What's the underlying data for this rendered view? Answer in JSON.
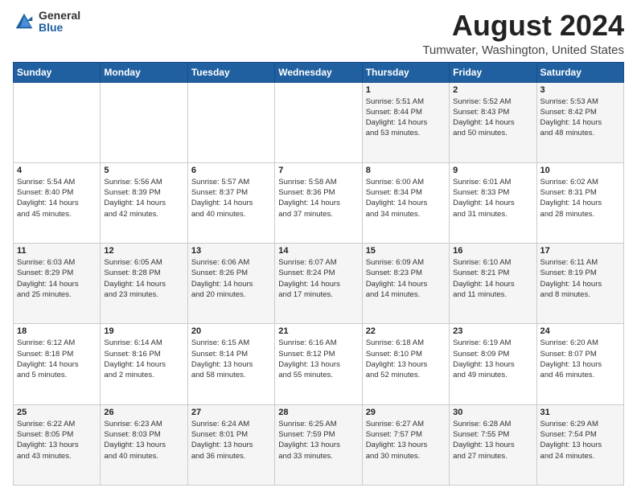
{
  "logo": {
    "general": "General",
    "blue": "Blue"
  },
  "header": {
    "title": "August 2024",
    "subtitle": "Tumwater, Washington, United States"
  },
  "calendar": {
    "days_of_week": [
      "Sunday",
      "Monday",
      "Tuesday",
      "Wednesday",
      "Thursday",
      "Friday",
      "Saturday"
    ],
    "weeks": [
      [
        {
          "day": "",
          "info": ""
        },
        {
          "day": "",
          "info": ""
        },
        {
          "day": "",
          "info": ""
        },
        {
          "day": "",
          "info": ""
        },
        {
          "day": "1",
          "info": "Sunrise: 5:51 AM\nSunset: 8:44 PM\nDaylight: 14 hours\nand 53 minutes."
        },
        {
          "day": "2",
          "info": "Sunrise: 5:52 AM\nSunset: 8:43 PM\nDaylight: 14 hours\nand 50 minutes."
        },
        {
          "day": "3",
          "info": "Sunrise: 5:53 AM\nSunset: 8:42 PM\nDaylight: 14 hours\nand 48 minutes."
        }
      ],
      [
        {
          "day": "4",
          "info": "Sunrise: 5:54 AM\nSunset: 8:40 PM\nDaylight: 14 hours\nand 45 minutes."
        },
        {
          "day": "5",
          "info": "Sunrise: 5:56 AM\nSunset: 8:39 PM\nDaylight: 14 hours\nand 42 minutes."
        },
        {
          "day": "6",
          "info": "Sunrise: 5:57 AM\nSunset: 8:37 PM\nDaylight: 14 hours\nand 40 minutes."
        },
        {
          "day": "7",
          "info": "Sunrise: 5:58 AM\nSunset: 8:36 PM\nDaylight: 14 hours\nand 37 minutes."
        },
        {
          "day": "8",
          "info": "Sunrise: 6:00 AM\nSunset: 8:34 PM\nDaylight: 14 hours\nand 34 minutes."
        },
        {
          "day": "9",
          "info": "Sunrise: 6:01 AM\nSunset: 8:33 PM\nDaylight: 14 hours\nand 31 minutes."
        },
        {
          "day": "10",
          "info": "Sunrise: 6:02 AM\nSunset: 8:31 PM\nDaylight: 14 hours\nand 28 minutes."
        }
      ],
      [
        {
          "day": "11",
          "info": "Sunrise: 6:03 AM\nSunset: 8:29 PM\nDaylight: 14 hours\nand 25 minutes."
        },
        {
          "day": "12",
          "info": "Sunrise: 6:05 AM\nSunset: 8:28 PM\nDaylight: 14 hours\nand 23 minutes."
        },
        {
          "day": "13",
          "info": "Sunrise: 6:06 AM\nSunset: 8:26 PM\nDaylight: 14 hours\nand 20 minutes."
        },
        {
          "day": "14",
          "info": "Sunrise: 6:07 AM\nSunset: 8:24 PM\nDaylight: 14 hours\nand 17 minutes."
        },
        {
          "day": "15",
          "info": "Sunrise: 6:09 AM\nSunset: 8:23 PM\nDaylight: 14 hours\nand 14 minutes."
        },
        {
          "day": "16",
          "info": "Sunrise: 6:10 AM\nSunset: 8:21 PM\nDaylight: 14 hours\nand 11 minutes."
        },
        {
          "day": "17",
          "info": "Sunrise: 6:11 AM\nSunset: 8:19 PM\nDaylight: 14 hours\nand 8 minutes."
        }
      ],
      [
        {
          "day": "18",
          "info": "Sunrise: 6:12 AM\nSunset: 8:18 PM\nDaylight: 14 hours\nand 5 minutes."
        },
        {
          "day": "19",
          "info": "Sunrise: 6:14 AM\nSunset: 8:16 PM\nDaylight: 14 hours\nand 2 minutes."
        },
        {
          "day": "20",
          "info": "Sunrise: 6:15 AM\nSunset: 8:14 PM\nDaylight: 13 hours\nand 58 minutes."
        },
        {
          "day": "21",
          "info": "Sunrise: 6:16 AM\nSunset: 8:12 PM\nDaylight: 13 hours\nand 55 minutes."
        },
        {
          "day": "22",
          "info": "Sunrise: 6:18 AM\nSunset: 8:10 PM\nDaylight: 13 hours\nand 52 minutes."
        },
        {
          "day": "23",
          "info": "Sunrise: 6:19 AM\nSunset: 8:09 PM\nDaylight: 13 hours\nand 49 minutes."
        },
        {
          "day": "24",
          "info": "Sunrise: 6:20 AM\nSunset: 8:07 PM\nDaylight: 13 hours\nand 46 minutes."
        }
      ],
      [
        {
          "day": "25",
          "info": "Sunrise: 6:22 AM\nSunset: 8:05 PM\nDaylight: 13 hours\nand 43 minutes."
        },
        {
          "day": "26",
          "info": "Sunrise: 6:23 AM\nSunset: 8:03 PM\nDaylight: 13 hours\nand 40 minutes."
        },
        {
          "day": "27",
          "info": "Sunrise: 6:24 AM\nSunset: 8:01 PM\nDaylight: 13 hours\nand 36 minutes."
        },
        {
          "day": "28",
          "info": "Sunrise: 6:25 AM\nSunset: 7:59 PM\nDaylight: 13 hours\nand 33 minutes."
        },
        {
          "day": "29",
          "info": "Sunrise: 6:27 AM\nSunset: 7:57 PM\nDaylight: 13 hours\nand 30 minutes."
        },
        {
          "day": "30",
          "info": "Sunrise: 6:28 AM\nSunset: 7:55 PM\nDaylight: 13 hours\nand 27 minutes."
        },
        {
          "day": "31",
          "info": "Sunrise: 6:29 AM\nSunset: 7:54 PM\nDaylight: 13 hours\nand 24 minutes."
        }
      ]
    ]
  }
}
